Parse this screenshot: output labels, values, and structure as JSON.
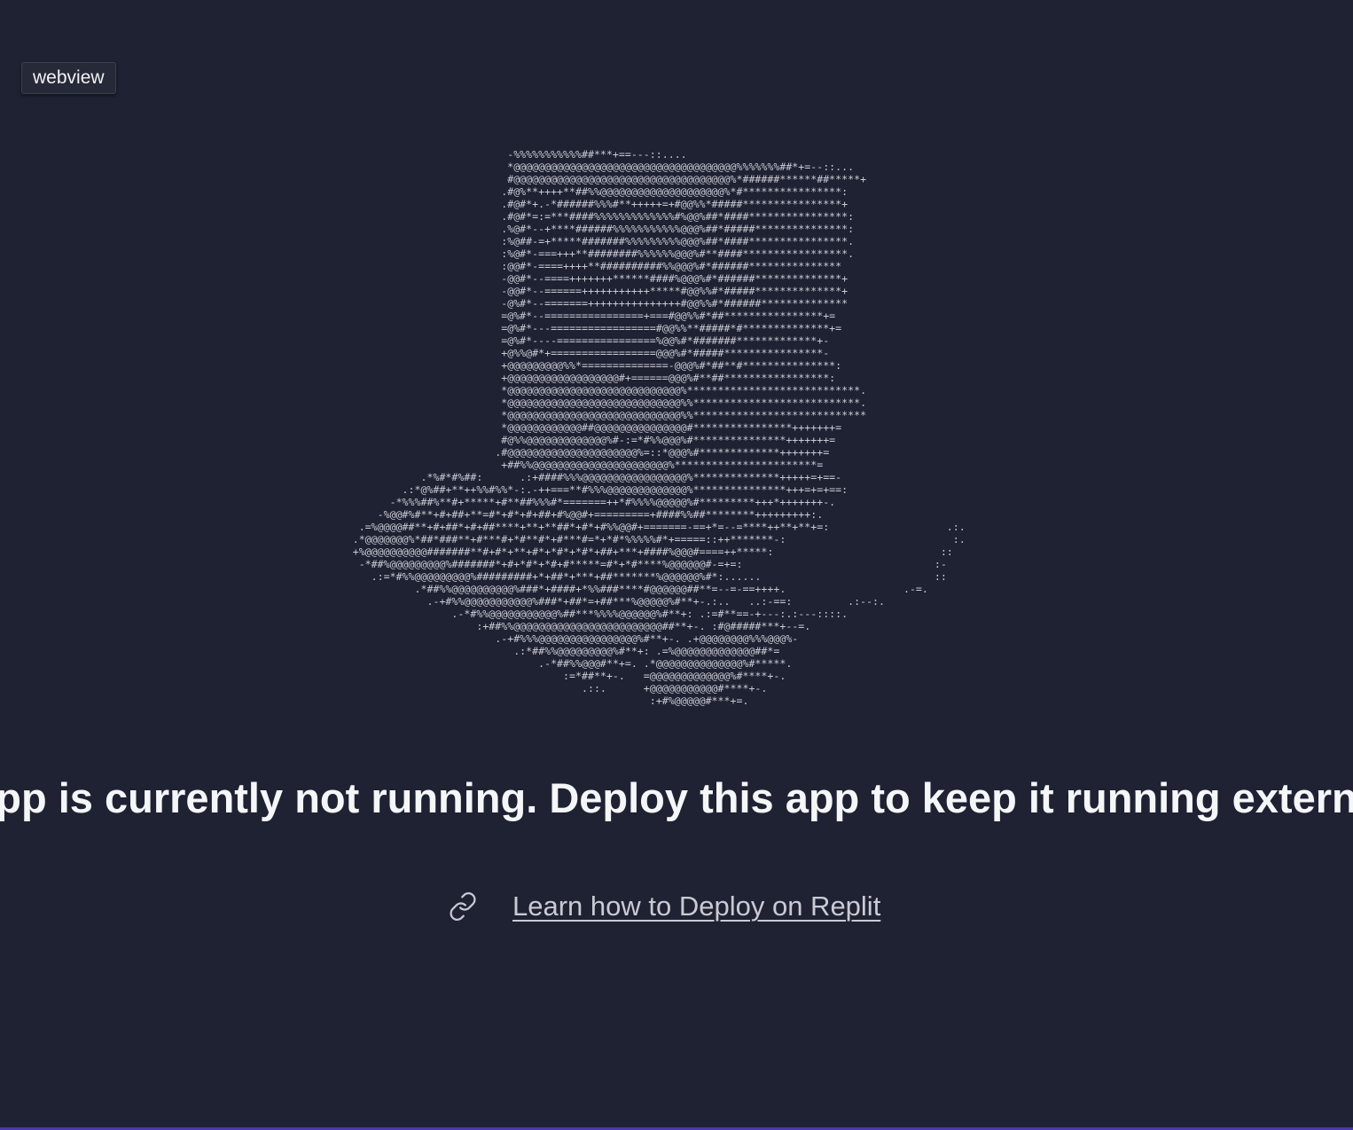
{
  "tag": {
    "label": "webview"
  },
  "ascii_art": "                                       -%%%%%%%%%%%##***+==---::....\n                                       *@@@@@@@@@@@@@@@@@@@@@@@@@@@@@@@@@@@@%%%%%%%##*+=--::...\n                                       #@@@@@@@@@@@@@@@@@@@@@@@@@@@@@@@@@@@%*######******##*****+\n                                      .#@%**++++**##%%@@@@@@@@@@@@@@@@@@@@%*#****************:\n                                      .#@#*+.-*######%%%#**+++++=+#@@%%*#####****************+\n                                      .#@#*=:=***####%%%%%%%%%%%%%#%@@%##*####****************:\n                                      .%@#*--+****######%%%%%%%%%%%@@@%##*#####***************:\n                                      :%@##-=+*****#######%%%%%%%%%@@@%##*####****************.\n                                      :%@#*-===+++**########%%%%%%@@@%#**####*****************.\n                                      :@@#*-====++++**##########%%@@@%#*######***************\n                                      -@@#*--====+++++++******####%@@@%#*######**************+\n                                      -@@#*--======+++++++++++*****#@@%%#*#####**************+\n                                      -@%#*--=======+++++++++++++++#@@%%#*######**************\n                                      =@%#*--================+===#@@%%#*##****************+=\n                                      =@%#*---=================#@@%%**#####*#**************+=\n                                      =@%#*----================%@@%#*#######*************+-\n                                      +@%%@#*+=================@@@%#*#####****************-\n                                      +@@@@@@@@@%%*==============-@@@%#*##**#***************:\n                                      +@@@@@@@@@@@@@@@@@@#+======@@@%#**##*****************:\n                                      *@@@@@@@@@@@@@@@@@@@@@@@@@@@@%****************************.\n                                      *@@@@@@@@@@@@@@@@@@@@@@@@@@@@%%***************************.\n                                      *@@@@@@@@@@@@@@@@@@@@@@@@@@@@%%****************************\n                                      *@@@@@@@@@@@@##@@@@@@@@@@@@@@@#****************+++++++=\n                                      #@%%@@@@@@@@@@@@@%#-:=*#%%@@@%#***************+++++++=\n                                     .#@@@@@@@@@@@@@@@@@@@@@%=::*@@@%#*************+++++++=\n                                      +##%%@@@@@@@@@@@@@@@@@@@@@@%***********************=\n                         .*%#*#%##:      .:+####%%%@@@@@@@@@@@@@@@@@%**************+++++=+==-\n                      .:*@%##+**++%%#%%*-:.-++===**#%%%@@@@@@@@@@@@@%***************+++=+=+==:\n                    -*%%%##%**#+*****+#**##%%%#*=======++*#%%%%@@@@@%#*********+++*+++++++-.\n                  -%@@#%#**+#+##+**=#*+#*+#+##+#%@@#+=========+####%%##********+++++++++:.\n               .=%@@@@##**+#+##*+#+##****+**+**##*+#*+#%%@@#+=======-==+*=--=****++**+**+=:                   .:.\n              .*@@@@@@@%*##*###**+#***#+*#**#*+#***#=*+*#*%%%%%#*+=====::++*******-:                           :.\n              +%@@@@@@@@@@#######**#+#*+**+#*+*#*+*#*+##+***+####%@@@#====++*****:                           ::\n               -*##%@@@@@@@@@%#######*+#+*#*+*#+#*****=#*+*#****%@@@@@@#-=+=:                               :-\n                 .:=*#%%@@@@@@@@@%#########+*+##*+***+##*******%@@@@@@%#*:......                            ::\n                        .*##%%@@@@@@@@@@%###*+####+*%%###****#@@@@@@##**=--=-==++++.                   .-=.\n                          .-+#%%@@@@@@@@@@@%###*+##*=+##***%@@@@@%#**+-.:..   ..:-==:         .:--:.\n                              .-*#%%@@@@@@@@@@@%##***%%%%@@@@@@%#**+: .:=#**==-+---:.:---::::.\n                                  :+##%%@@@@@@@@@@@@@@@@@@@@@@@@##**+-. :#@#####***+--=.\n                                     .-+#%%%@@@@@@@@@@@@@@@@%#**+-. .+@@@@@@@@%%%@@@%-\n                                        .:*##%%@@@@@@@@@%#**+: .=%@@@@@@@@@@@@@##*=\n                                            .-*##%%@@@#**+=. .*@@@@@@@@@@@@@@%#*****.\n                                                :=*##**+-.   =@@@@@@@@@@@@@%#****+-.\n                                                   .::.      +@@@@@@@@@@@#****+-.\n                                                              :+#%@@@@@#***+=.",
  "main": {
    "headline": "pp is currently not running. Deploy this app to keep it running extern",
    "learn_link": "Learn how to Deploy on Replit"
  },
  "icons": {
    "link": "link-icon"
  },
  "colors": {
    "background": "#1e2233",
    "text": "#f5f6f8",
    "link": "#c8cbd3",
    "accent_line": "#4b37b2"
  }
}
